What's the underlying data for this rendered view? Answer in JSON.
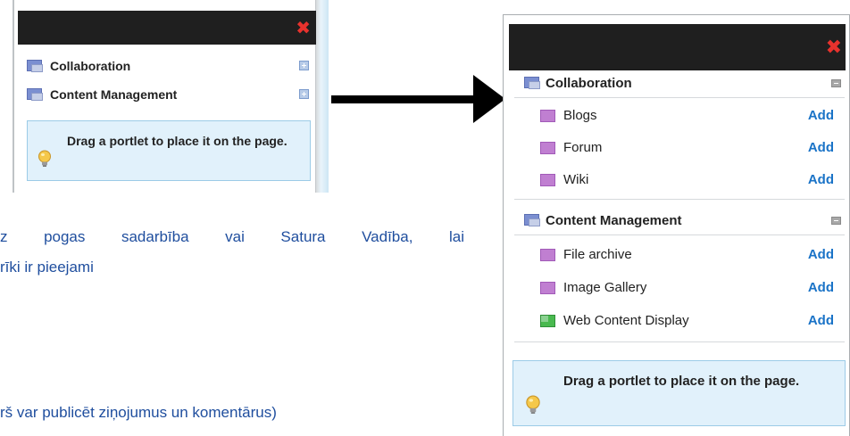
{
  "small_panel": {
    "categories": [
      {
        "label": "Collaboration",
        "icon": "category-window-icon",
        "toggle": "expand-plus-icon"
      },
      {
        "label": "Content Management",
        "icon": "category-window-icon",
        "toggle": "expand-plus-icon"
      }
    ],
    "tip": "Drag a portlet to place it on the page."
  },
  "big_panel": {
    "categories": [
      {
        "label": "Collaboration",
        "items": [
          {
            "name": "Blogs",
            "action": "Add",
            "icon": "portlet-purple-icon"
          },
          {
            "name": "Forum",
            "action": "Add",
            "icon": "portlet-purple-icon"
          },
          {
            "name": "Wiki",
            "action": "Add",
            "icon": "portlet-purple-icon"
          }
        ]
      },
      {
        "label": "Content Management",
        "items": [
          {
            "name": "File archive",
            "action": "Add",
            "icon": "portlet-purple-icon"
          },
          {
            "name": "Image Gallery",
            "action": "Add",
            "icon": "portlet-purple-icon"
          },
          {
            "name": "Web Content Display",
            "action": "Add",
            "icon": "portlet-green-icon"
          }
        ]
      }
    ],
    "tip": "Drag a portlet to place it on the page."
  },
  "description": {
    "line1": "z pogas sadarbība vai Satura Vadība, lai",
    "line2": "rīki ir pieejami",
    "line3": "rš var publicēt ziņojumus un komentārus)"
  },
  "colors": {
    "header": "#1f1f1f",
    "close": "#e8322d",
    "link": "#1a73c7",
    "tip_bg": "#e1f1fb",
    "desc_text": "#1f4e9e"
  }
}
